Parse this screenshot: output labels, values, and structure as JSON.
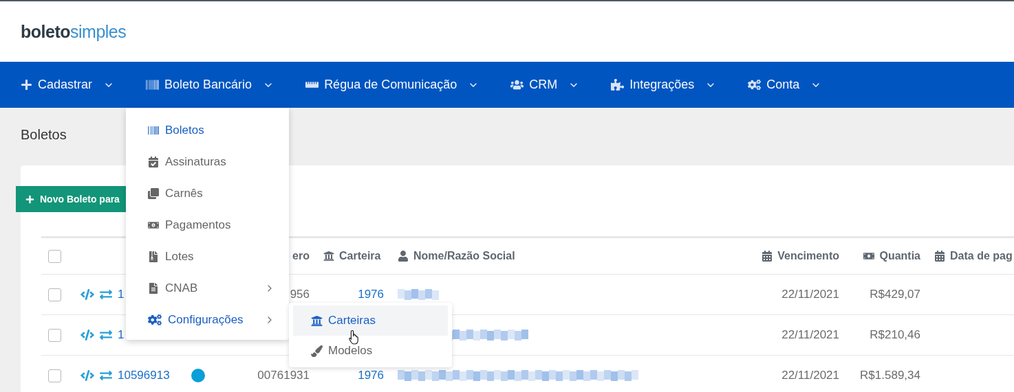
{
  "logo": {
    "bold": "boleto",
    "light": "simples"
  },
  "nav": [
    {
      "label": "Cadastrar"
    },
    {
      "label": "Boleto Bancário"
    },
    {
      "label": "Régua de Comunicação"
    },
    {
      "label": "CRM"
    },
    {
      "label": "Integrações"
    },
    {
      "label": "Conta"
    }
  ],
  "page_title": "Boletos",
  "new_button": "Novo Boleto para",
  "table": {
    "select_all_checked": false,
    "columns": [
      "ero",
      "Carteira",
      "Nome/Razão Social",
      "Vencimento",
      "Quantia",
      "Data de pag"
    ],
    "rows": [
      {
        "checked": false,
        "id": "1",
        "numero": "956",
        "carteira": "1976",
        "vencimento": "22/11/2021",
        "quantia": "R$429,07"
      },
      {
        "checked": false,
        "id": "1",
        "vencimento": "22/11/2021",
        "quantia": "R$210,46"
      },
      {
        "checked": false,
        "id": "10596913",
        "color": "#0a9fd8",
        "numero": "00761931",
        "carteira": "1976",
        "vencimento": "22/11/2021",
        "quantia": "R$1.589,34"
      }
    ]
  },
  "menu": {
    "items": [
      {
        "label": "Boletos",
        "selected": true,
        "has_submenu": false
      },
      {
        "label": "Assinaturas",
        "selected": false,
        "has_submenu": false
      },
      {
        "label": "Carnês",
        "selected": false,
        "has_submenu": false
      },
      {
        "label": "Pagamentos",
        "selected": false,
        "has_submenu": false
      },
      {
        "label": "Lotes",
        "selected": false,
        "has_submenu": false
      },
      {
        "label": "CNAB",
        "selected": false,
        "has_submenu": true
      },
      {
        "label": "Configurações",
        "selected": true,
        "has_submenu": true
      }
    ]
  },
  "submenu": {
    "items": [
      {
        "label": "Carteiras",
        "selected": true
      },
      {
        "label": "Modelos",
        "selected": false
      }
    ]
  }
}
